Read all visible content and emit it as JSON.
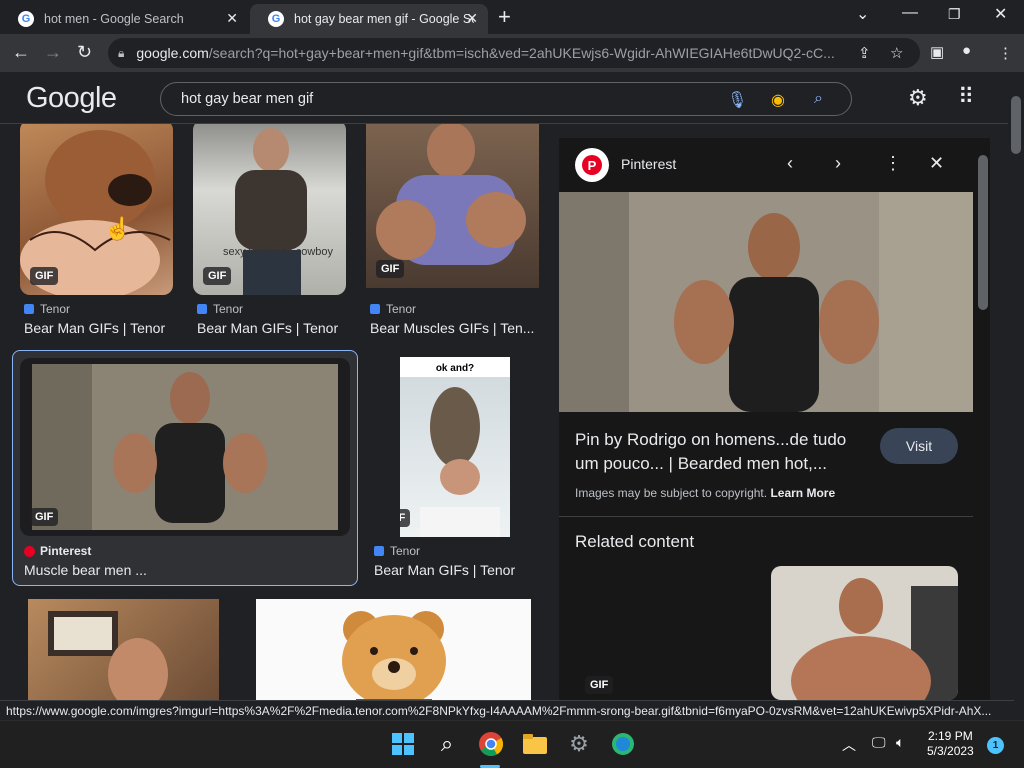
{
  "browser": {
    "tabs": [
      {
        "title": "hot men - Google Search",
        "active": false
      },
      {
        "title": "hot gay bear men gif - Google Se",
        "active": true
      }
    ],
    "new_tab": "+",
    "url_host": "google.com",
    "url_path": "/search?q=hot+gay+bear+men+gif&tbm=isch&ved=2ahUKEwjs6-Wgidr-AhWIEGIAHe6tDwUQ2-cC..."
  },
  "google": {
    "logo": "Google",
    "query": "hot gay bear men gif"
  },
  "results": [
    {
      "source": "Tenor",
      "title": "Bear Man GIFs | Tenor",
      "badge": "GIF"
    },
    {
      "source": "Tenor",
      "title": "Bear Man GIFs | Tenor",
      "badge": "GIF",
      "caption": "sexy very nice cowboy"
    },
    {
      "source": "Tenor",
      "title": "Bear Muscles GIFs | Ten...",
      "badge": "GIF"
    },
    {
      "source": "Pinterest",
      "title": "Muscle bear men ...",
      "badge": "GIF",
      "selected": true
    },
    {
      "source": "Tenor",
      "title": "Bear Man GIFs | Tenor",
      "badge": "GIF",
      "overlay": "ok and?"
    }
  ],
  "panel": {
    "site": "Pinterest",
    "title": "Pin by Rodrigo on homens...de tudo um pouco... | Bearded men hot,...",
    "visit": "Visit",
    "copyright": "Images may be subject to copyright.",
    "learn_more": "Learn More",
    "related": "Related content",
    "related_badge": "GIF"
  },
  "status_url": "https://www.google.com/imgres?imgurl=https%3A%2F%2Fmedia.tenor.com%2F8NPkYfxg-I4AAAAM%2Fmmm-srong-bear.gif&tbnid=f6myaPO-0zvsRM&vet=12ahUKEwivp5XPidr-AhX...",
  "taskbar": {
    "time": "2:19 PM",
    "date": "5/3/2023",
    "notifications": "1"
  }
}
